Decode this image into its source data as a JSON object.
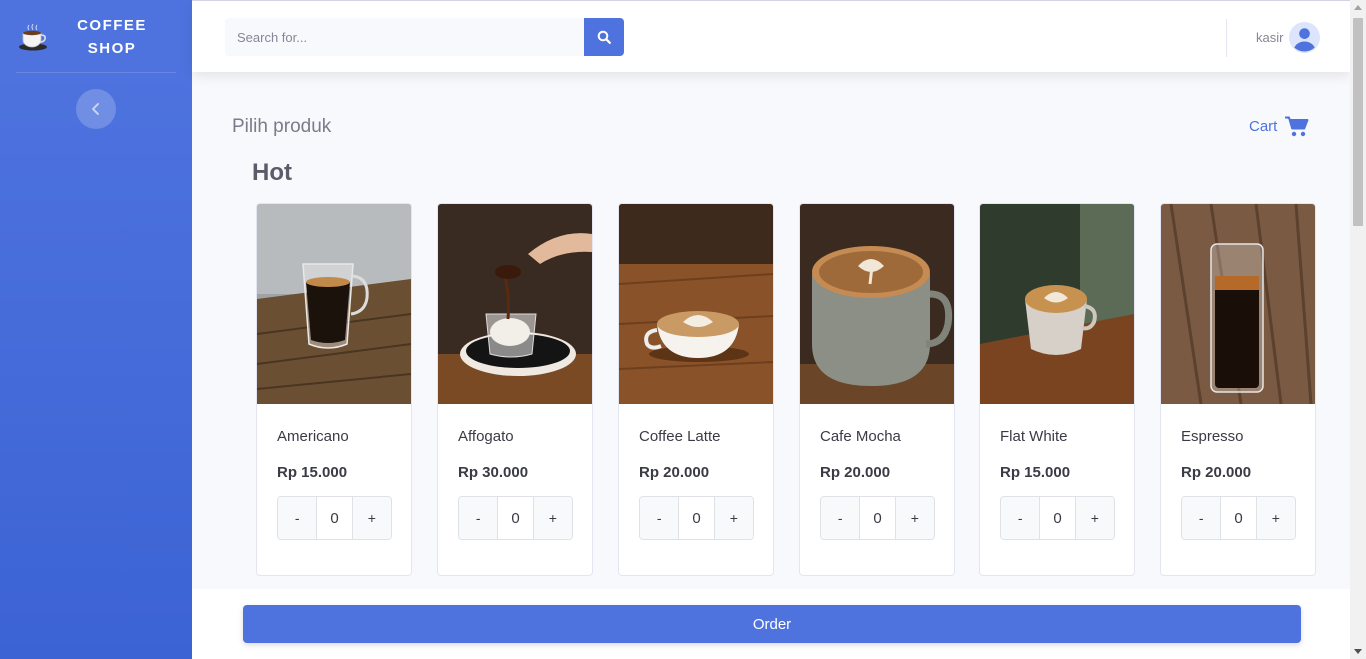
{
  "brand": {
    "line1": "COFFEE",
    "line2": "SHOP",
    "logo_icon": "coffee-cup-icon"
  },
  "sidebar": {
    "toggle_icon": "chevron-left-icon"
  },
  "search": {
    "placeholder": "Search for...",
    "value": "",
    "icon": "search-icon"
  },
  "user": {
    "name": "kasir",
    "icon": "user-avatar-icon"
  },
  "page": {
    "title": "Pilih produk",
    "cart_label": "Cart",
    "cart_icon": "shopping-cart-icon",
    "section_title": "Hot"
  },
  "products": [
    {
      "name": "Americano",
      "price": "Rp 15.000",
      "qty": "0",
      "minus": "-",
      "plus": "+"
    },
    {
      "name": "Affogato",
      "price": "Rp 30.000",
      "qty": "0",
      "minus": "-",
      "plus": "+"
    },
    {
      "name": "Coffee Latte",
      "price": "Rp 20.000",
      "qty": "0",
      "minus": "-",
      "plus": "+"
    },
    {
      "name": "Cafe Mocha",
      "price": "Rp 20.000",
      "qty": "0",
      "minus": "-",
      "plus": "+"
    },
    {
      "name": "Flat White",
      "price": "Rp 15.000",
      "qty": "0",
      "minus": "-",
      "plus": "+"
    },
    {
      "name": "Espresso",
      "price": "Rp 20.000",
      "qty": "0",
      "minus": "-",
      "plus": "+"
    }
  ],
  "footer": {
    "order_label": "Order"
  },
  "colors": {
    "primary": "#4e73df",
    "sidebar_dark": "#3c63d4",
    "text_dark": "#3a3b45",
    "text_muted": "#858796"
  }
}
